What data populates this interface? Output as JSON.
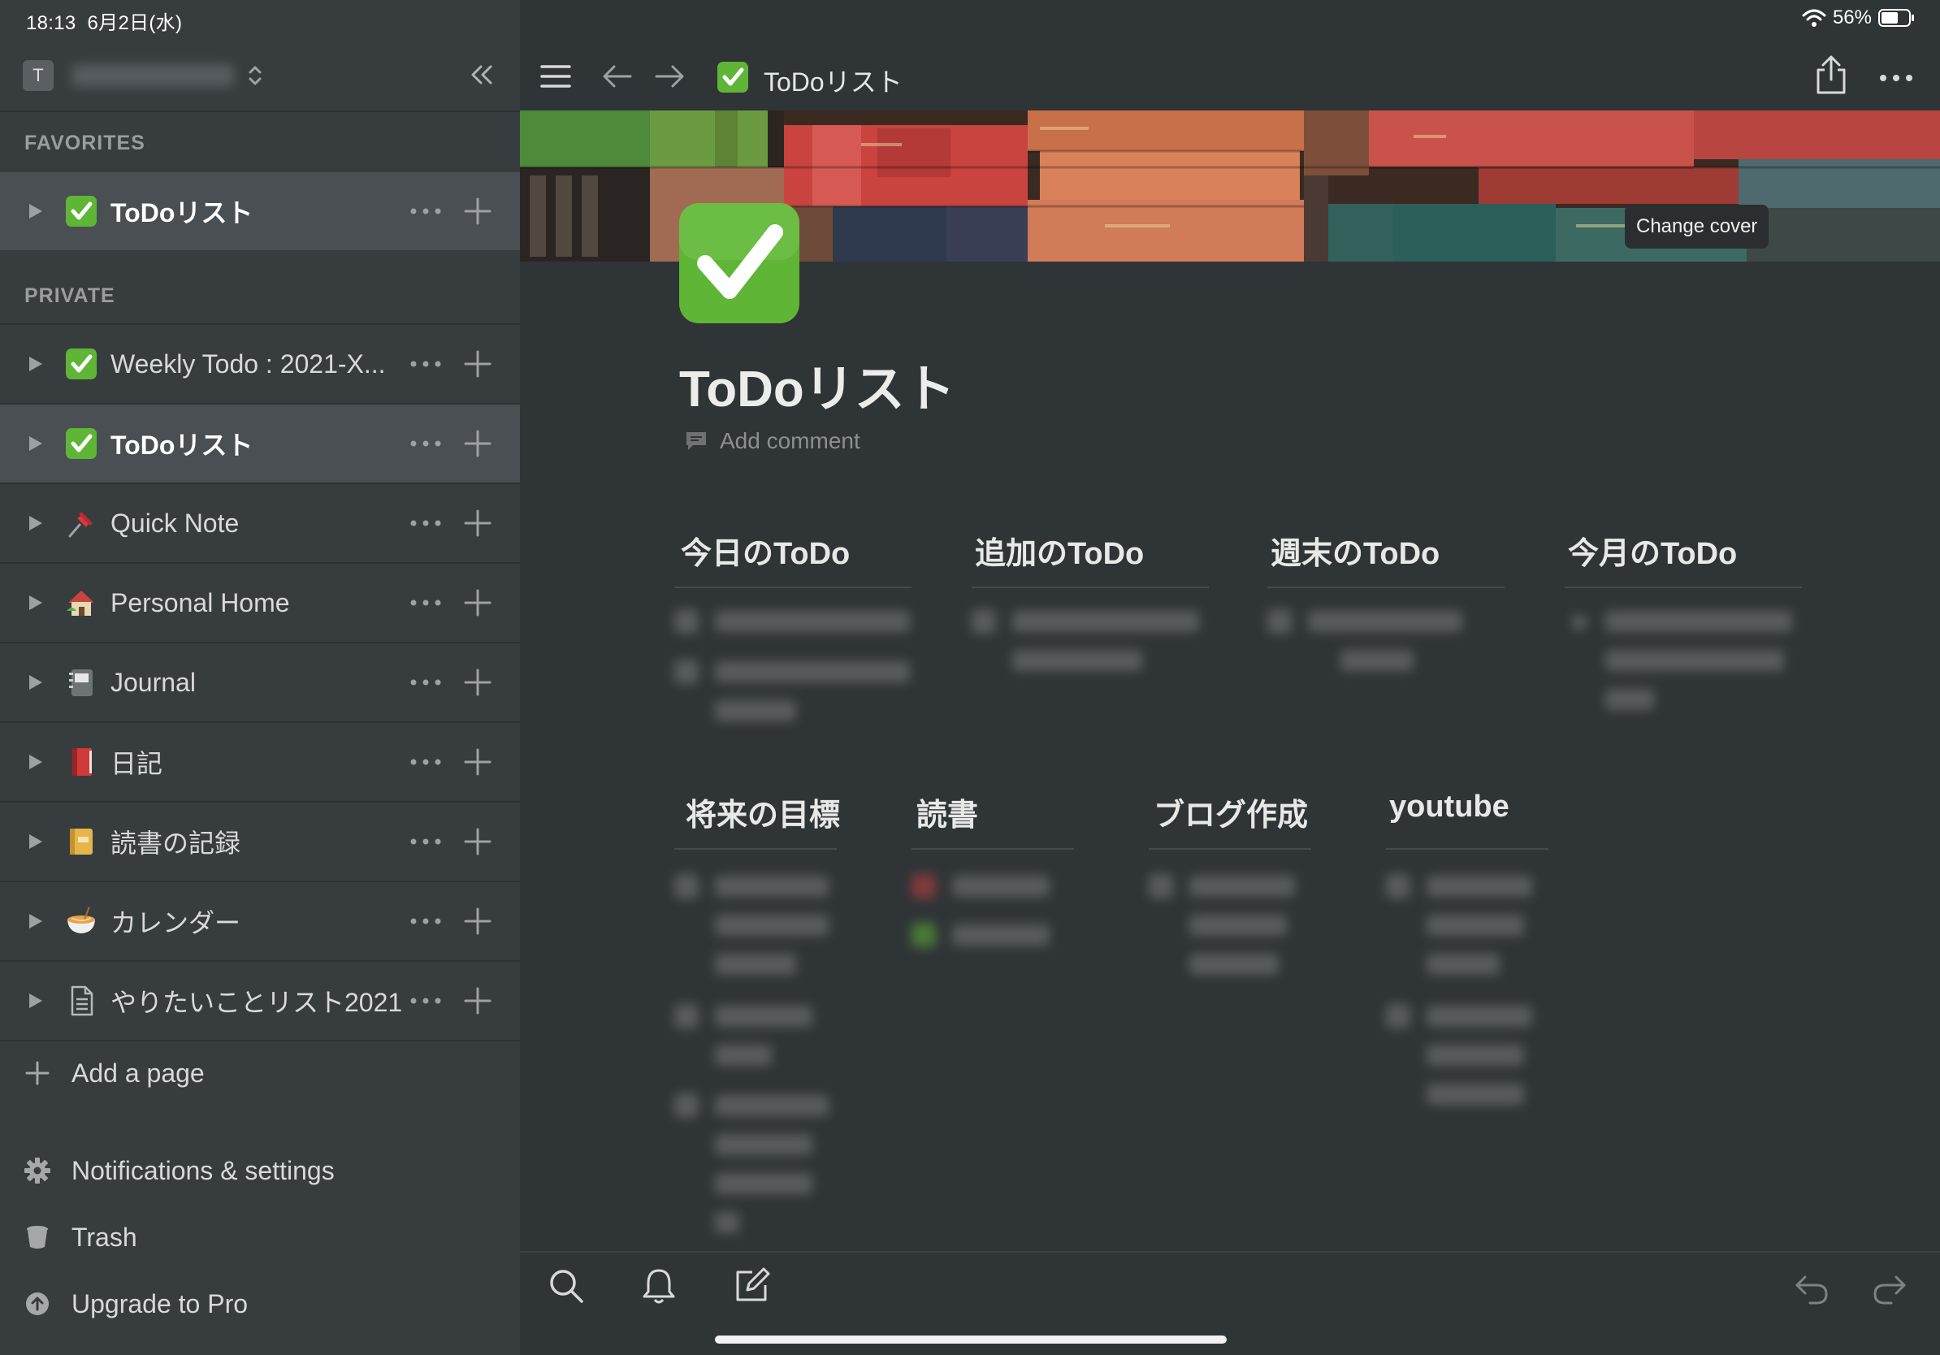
{
  "status": {
    "time_date": "18:13  6月2日(水)",
    "battery": "56%"
  },
  "sidebar": {
    "workspace_initial": "T",
    "favorites_label": "FAVORITES",
    "private_label": "PRIVATE",
    "favorites": [
      {
        "label": "ToDoリスト",
        "icon": "check-mark-icon"
      }
    ],
    "pages": [
      {
        "label": "Weekly Todo : 2021-X...",
        "icon": "check-mark-icon"
      },
      {
        "label": "ToDoリスト",
        "icon": "check-mark-icon"
      },
      {
        "label": "Quick Note",
        "icon": "pushpin-icon"
      },
      {
        "label": "Personal Home",
        "icon": "house-icon"
      },
      {
        "label": "Journal",
        "icon": "notebook-icon"
      },
      {
        "label": "日記",
        "icon": "red-book-icon"
      },
      {
        "label": "読書の記録",
        "icon": "ledger-icon"
      },
      {
        "label": "カレンダー",
        "icon": "noodle-bowl-icon"
      },
      {
        "label": "やりたいことリスト2021",
        "icon": "document-icon"
      }
    ],
    "add_page": "Add a page",
    "notifications": "Notifications & settings",
    "trash": "Trash",
    "upgrade": "Upgrade to Pro"
  },
  "topbar": {
    "title": "ToDoリスト"
  },
  "page": {
    "change_cover": "Change cover",
    "title": "ToDoリスト",
    "add_comment": "Add comment",
    "columns_row1": [
      "今日のToDo",
      "追加のToDo",
      "週末のToDo",
      "今月のToDo"
    ],
    "columns_row2": [
      "将来の目標",
      "読書",
      "ブログ作成",
      "youtube"
    ]
  },
  "colors": {
    "sidebar_bg": "#373c3f",
    "main_bg": "#2f3437",
    "active_row": "#4a4f53",
    "check_green": "#5fb536"
  }
}
